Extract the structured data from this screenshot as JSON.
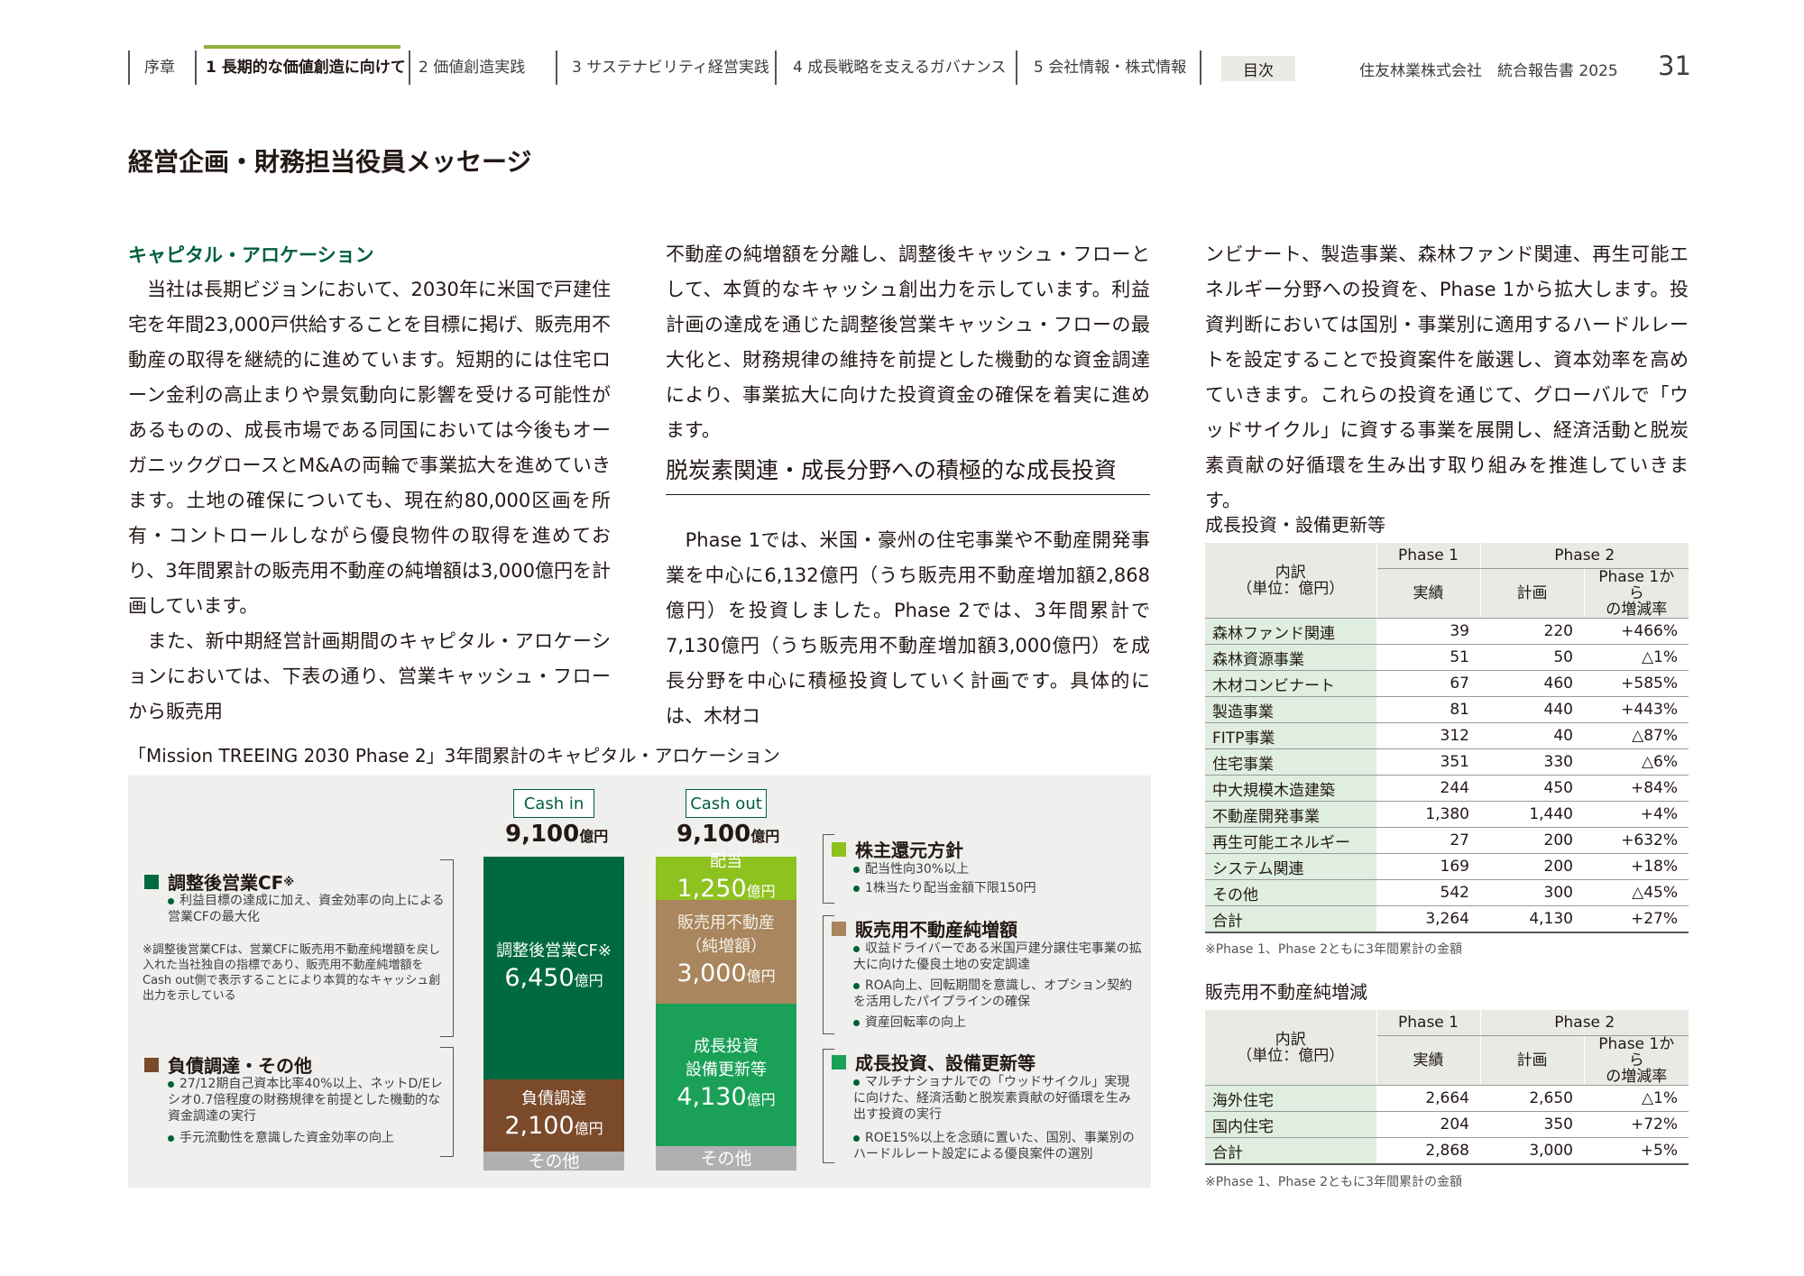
{
  "header": {
    "nav": [
      "序章",
      "1 長期的な価値創造に向けて",
      "2 価値創造実践",
      "3 サステナビリティ経営実践",
      "4 成長戦略を支えるガバナンス",
      "5 会社情報・株式情報"
    ],
    "active_index": 1,
    "toc": "目次",
    "corp": "住友林業株式会社　統合報告書 2025",
    "page": "31"
  },
  "page_title": "経営企画・財務担当役員メッセージ",
  "section1": {
    "heading": "キャピタル・アロケーション",
    "p1": "　当社は長期ビジョンにおいて、2030年に米国で戸建住宅を年間23,000戸供給することを目標に掲げ、販売用不動産の取得を継続的に進めています。短期的には住宅ローン金利の高止まりや景気動向に影響を受ける可能性があるものの、成長市場である同国においては今後もオーガニックグロースとM&Aの両輪で事業拡大を進めていきます。土地の確保についても、現在約80,000区画を所有・コントロールしながら優良物件の取得を進めており、3年間累計の販売用不動産の純増額は3,000億円を計画しています。",
    "p2": "　また、新中期経営計画期間のキャピタル・アロケーションにおいては、下表の通り、営業キャッシュ・フローから販売用",
    "p2_cont": "不動産の純増額を分離し、調整後キャッシュ・フローとして、本質的なキャッシュ創出力を示しています。利益計画の達成を通じた調整後営業キャッシュ・フローの最大化と、財務規律の維持を前提とした機動的な資金調達により、事業拡大に向けた投資資金の確保を着実に進めます。"
  },
  "section2": {
    "heading": "脱炭素関連・成長分野への積極的な成長投資",
    "p1": "　Phase 1では、米国・豪州の住宅事業や不動産開発事業を中心に6,132億円（うち販売用不動産増加額2,868億円）を投資しました。Phase 2では、3年間累計で7,130億円（うち販売用不動産増加額3,000億円）を成長分野を中心に積極投資していく計画です。具体的には、木材コ",
    "p1_cont": "ンビナート、製造事業、森林ファンド関連、再生可能エネルギー分野への投資を、Phase 1から拡大します。投資判断においては国別・事業別に適用するハードルレートを設定することで投資案件を厳選し、資本効率を高めていきます。これらの投資を通じて、グローバルで「ウッドサイクル」に資する事業を展開し、経済活動と脱炭素貢献の好循環を生み出す取り組みを推進していきます。"
  },
  "diagram": {
    "title": "「Mission TREEING 2030 Phase 2」3年間累計のキャピタル・アロケーション",
    "cash_in": "Cash in",
    "cash_out": "Cash out",
    "total_in": "9,100",
    "total_out": "9,100",
    "unit": "億円",
    "in_blocks": [
      {
        "label": "調整後営業CF※",
        "value": "6,450",
        "share": 0.709
      },
      {
        "label": "負債調達",
        "value": "2,100",
        "share": 0.231
      },
      {
        "label": "その他",
        "value": "",
        "share": 0.06
      }
    ],
    "out_blocks": [
      {
        "label": "配当",
        "value": "1,250",
        "share": 0.137
      },
      {
        "label": "販売用不動産\n（純増額）",
        "value": "3,000",
        "share": 0.33
      },
      {
        "label": "成長投資\n設備更新等",
        "value": "4,130",
        "share": 0.454
      },
      {
        "label": "その他",
        "value": "",
        "share": 0.079
      }
    ],
    "left_legend": [
      {
        "title": "調整後営業CF",
        "mark": "※",
        "bullets": [
          "利益目標の達成に加え、資金効率の向上による営業CFの最大化"
        ],
        "note": "※調整後営業CFは、営業CFに販売用不動産純増額を戻し入れた当社独自の指標であり、販売用不動産純増額をCash out側で表示することにより本質的なキャッシュ創出力を示している"
      },
      {
        "title": "負債調達・その他",
        "mark": "",
        "bullets": [
          "27/12期自己資本比率40%以上、ネットD/Eレシオ0.7倍程度の財務規律を前提とした機動的な資金調達の実行",
          "手元流動性を意識した資金効率の向上"
        ],
        "note": ""
      }
    ],
    "right_legend": [
      {
        "title": "株主還元方針",
        "bullets": [
          "配当性向30%以上",
          "1株当たり配当金額下限150円"
        ]
      },
      {
        "title": "販売用不動産純増額",
        "bullets": [
          "収益ドライバーである米国戸建分譲住宅事業の拡大に向けた優良土地の安定調達",
          "ROA向上、回転期間を意識し、オプション契約を活用したパイプラインの確保",
          "資産回転率の向上"
        ]
      },
      {
        "title": "成長投資、設備更新等",
        "bullets": [
          "マルチナショナルでの「ウッドサイクル」実現に向けた、経済活動と脱炭素貢献の好循環を生み出す投資の実行",
          "ROE15%以上を念頭に置いた、国別、事業別のハードルレート設定による優良案件の選別"
        ]
      }
    ],
    "colors": {
      "dark_green": "#006940",
      "brown": "#7b4a2b",
      "lime": "#8dc21f",
      "tan": "#a9865d",
      "green": "#1aa157",
      "gray": "#b0b0b0"
    }
  },
  "table1": {
    "title": "成長投資・設備更新等",
    "h_item": "内訳\n（単位：億円）",
    "h_phase1": "Phase 1",
    "h_phase2": "Phase 2",
    "h_actual": "実績",
    "h_plan": "計画",
    "h_change": "Phase 1から\nの増減率",
    "rows": [
      [
        "森林ファンド関連",
        "39",
        "220",
        "+466%"
      ],
      [
        "森林資源事業",
        "51",
        "50",
        "△1%"
      ],
      [
        "木材コンビナート",
        "67",
        "460",
        "+585%"
      ],
      [
        "製造事業",
        "81",
        "440",
        "+443%"
      ],
      [
        "FITP事業",
        "312",
        "40",
        "△87%"
      ],
      [
        "住宅事業",
        "351",
        "330",
        "△6%"
      ],
      [
        "中大規模木造建築",
        "244",
        "450",
        "+84%"
      ],
      [
        "不動産開発事業",
        "1,380",
        "1,440",
        "+4%"
      ],
      [
        "再生可能エネルギー",
        "27",
        "200",
        "+632%"
      ],
      [
        "システム関連",
        "169",
        "200",
        "+18%"
      ],
      [
        "その他",
        "542",
        "300",
        "△45%"
      ]
    ],
    "total": [
      "合計",
      "3,264",
      "4,130",
      "+27%"
    ],
    "note": "※Phase 1、Phase 2ともに3年間累計の金額"
  },
  "table2": {
    "title": "販売用不動産純増減",
    "h_item": "内訳\n（単位：億円）",
    "h_phase1": "Phase 1",
    "h_phase2": "Phase 2",
    "h_actual": "実績",
    "h_plan": "計画",
    "h_change": "Phase 1から\nの増減率",
    "rows": [
      [
        "海外住宅",
        "2,664",
        "2,650",
        "△1%"
      ],
      [
        "国内住宅",
        "204",
        "350",
        "+72%"
      ]
    ],
    "total": [
      "合計",
      "2,868",
      "3,000",
      "+5%"
    ],
    "note": "※Phase 1、Phase 2ともに3年間累計の金額"
  }
}
